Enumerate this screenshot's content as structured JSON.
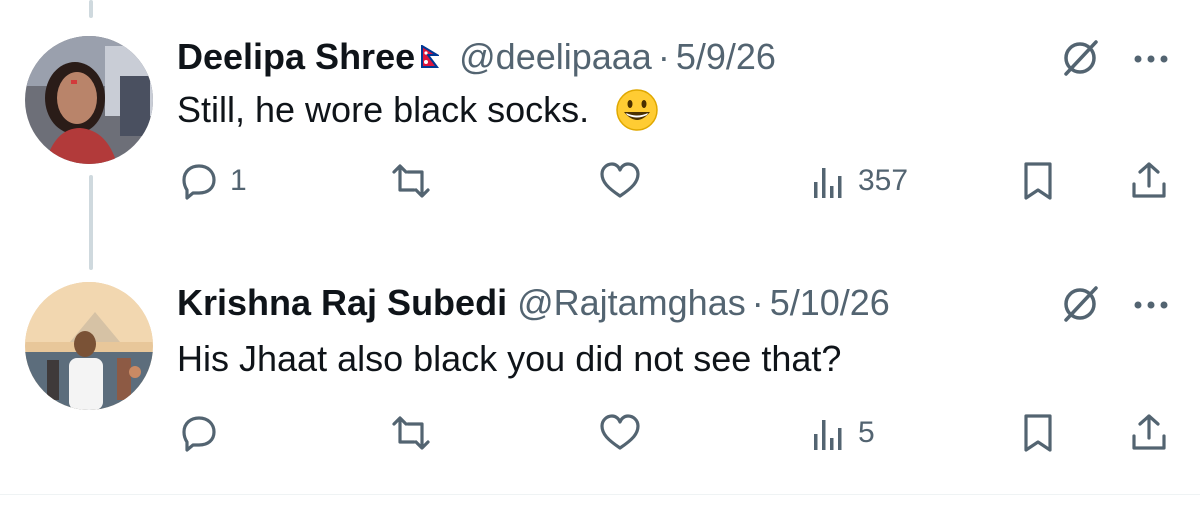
{
  "replies": [
    {
      "author_name": "Deelipa Shree",
      "flag": "nepal-flag",
      "handle": "@deelipaaa",
      "separator": "·",
      "date": "5/9/26",
      "text": "Still, he wore black socks.",
      "emoji": "grinning-face-emoji",
      "reply_count": "1",
      "repost_count": "",
      "like_count": "",
      "view_count": "357"
    },
    {
      "author_name": "Krishna Raj Subedi",
      "handle": "@Rajtamghas",
      "separator": "·",
      "date": "5/10/26",
      "text": "His Jhaat also black you did not see that?",
      "reply_count": "",
      "repost_count": "",
      "like_count": "",
      "view_count": "5"
    }
  ],
  "colors": {
    "text_primary": "#0f1419",
    "text_secondary": "#536471",
    "thread_line": "#cfd9de"
  }
}
